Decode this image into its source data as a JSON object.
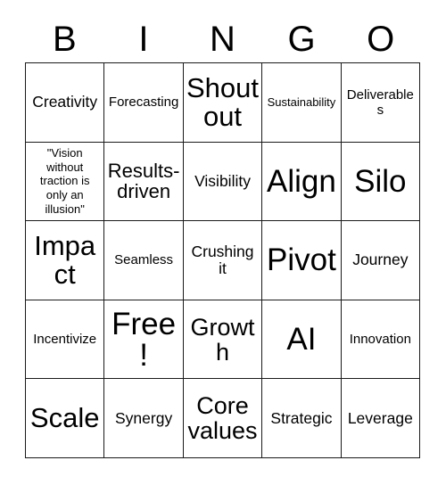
{
  "card": {
    "title": "BINGO",
    "header_letters": [
      "B",
      "I",
      "N",
      "G",
      "O"
    ],
    "grid_size": "5x5",
    "free_space": "Free!",
    "colors": {
      "background": "#ffffff",
      "grid_line": "#1a1a1a",
      "text": "#000000"
    },
    "rows": [
      [
        {
          "text": "Creativity",
          "size": "m"
        },
        {
          "text": "Forecasting",
          "size": "s"
        },
        {
          "text": "Shout out",
          "size": "xxl"
        },
        {
          "text": "Sustainability",
          "size": "xs"
        },
        {
          "text": "Deliverables",
          "size": "s"
        }
      ],
      [
        {
          "text": "\"Vision without traction is only an illusion\"",
          "size": "xs"
        },
        {
          "text": "Results-driven",
          "size": "l"
        },
        {
          "text": "Visibility",
          "size": "m"
        },
        {
          "text": "Align",
          "size": "3xl"
        },
        {
          "text": "Silo",
          "size": "3xl"
        }
      ],
      [
        {
          "text": "Impact",
          "size": "xxl"
        },
        {
          "text": "Seamless",
          "size": "s"
        },
        {
          "text": "Crushing it",
          "size": "m"
        },
        {
          "text": "Pivot",
          "size": "3xl"
        },
        {
          "text": "Journey",
          "size": "m"
        }
      ],
      [
        {
          "text": "Incentivize",
          "size": "s"
        },
        {
          "text": "Free!",
          "size": "3xl"
        },
        {
          "text": "Growth",
          "size": "xl"
        },
        {
          "text": "AI",
          "size": "3xl"
        },
        {
          "text": "Innovation",
          "size": "s"
        }
      ],
      [
        {
          "text": "Scale",
          "size": "xxl"
        },
        {
          "text": "Synergy",
          "size": "m"
        },
        {
          "text": "Core values",
          "size": "xl"
        },
        {
          "text": "Strategic",
          "size": "m"
        },
        {
          "text": "Leverage",
          "size": "m"
        }
      ]
    ]
  }
}
